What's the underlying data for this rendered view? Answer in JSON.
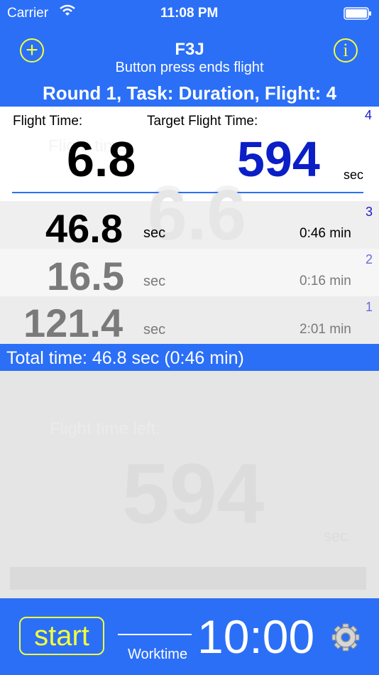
{
  "status": {
    "carrier": "Carrier",
    "time": "11:08 PM"
  },
  "header": {
    "title": "F3J",
    "subtitle": "Button press ends flight",
    "round_line": "Round 1, Task: Duration, Flight: 4"
  },
  "current": {
    "flight_time_label": "Flight Time:",
    "target_label": "Target Flight Time:",
    "flight_time_value": "6.8",
    "target_value": "594",
    "unit": "sec",
    "flight_index": "4",
    "ghost_label": "Flight time:",
    "ghost_value": "6.6",
    "ghost_unit": "sec"
  },
  "flights": [
    {
      "index": "3",
      "value": "46.8",
      "unit": "sec",
      "minutes": "0:46 min"
    },
    {
      "index": "2",
      "value": "16.5",
      "unit": "sec",
      "minutes": "0:16 min"
    },
    {
      "index": "1",
      "value": "121.4",
      "unit": "sec",
      "minutes": "2:01 min"
    }
  ],
  "total": {
    "text": "Total time:  46.8 sec (0:46 min)"
  },
  "ghost_panel": {
    "label": "Flight time left:",
    "value": "594",
    "unit": "sec"
  },
  "bottom": {
    "start_label": "start",
    "worktime_label": "Worktime",
    "timer": "10:00"
  },
  "colors": {
    "accent": "#2b6ff7",
    "yellow": "#f4ff3a",
    "target_blue": "#0b1fc6"
  }
}
